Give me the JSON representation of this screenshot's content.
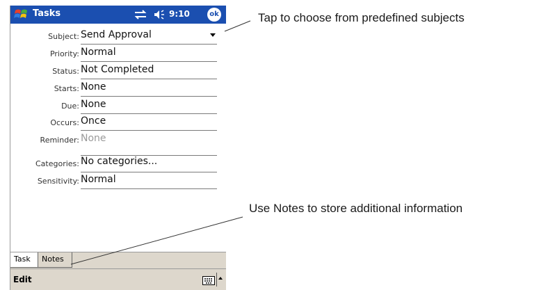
{
  "titlebar": {
    "app_title": "Tasks",
    "time": "9:10",
    "ok_label": "ok"
  },
  "form": {
    "fields": [
      {
        "label": "Subject:",
        "value": "Send Approval",
        "has_dropdown": true
      },
      {
        "label": "Priority:",
        "value": "Normal"
      },
      {
        "label": "Status:",
        "value": "Not Completed"
      },
      {
        "label": "Starts:",
        "value": "None"
      },
      {
        "label": "Due:",
        "value": "None"
      },
      {
        "label": "Occurs:",
        "value": "Once"
      },
      {
        "label": "Reminder:",
        "value": "None",
        "dimmed": true
      },
      {
        "label": "Categories:",
        "value": "No categories..."
      },
      {
        "label": "Sensitivity:",
        "value": "Normal"
      }
    ]
  },
  "tabs": [
    "Task",
    "Notes"
  ],
  "menubar": {
    "edit_label": "Edit"
  },
  "callouts": {
    "subjects": "Tap to choose from predefined subjects",
    "notes": "Use Notes to store additional information"
  },
  "colors": {
    "titlebar": "#1b4fb0",
    "chrome": "#ddd7cc"
  },
  "icons": [
    "windows-start-icon",
    "connectivity-icon",
    "speaker-icon",
    "keyboard-icon"
  ]
}
